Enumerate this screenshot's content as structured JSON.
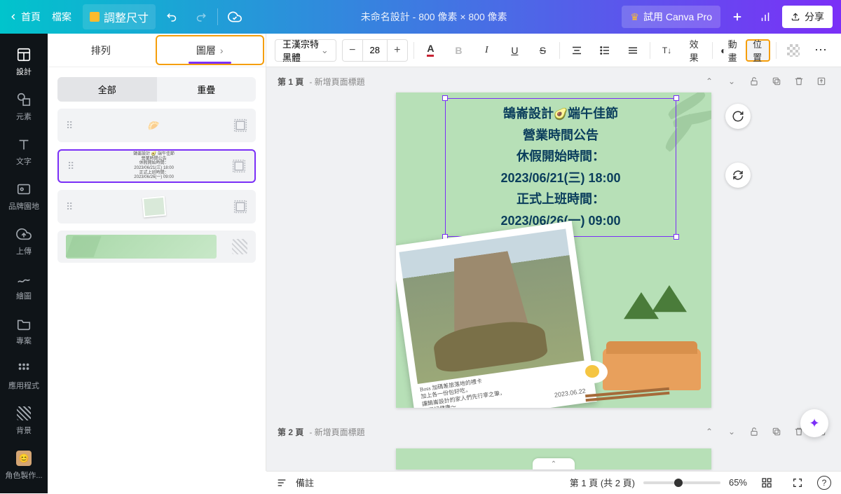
{
  "header": {
    "home": "首頁",
    "file": "檔案",
    "resize": "調整尺寸",
    "title": "未命名設計 - 800 像素 × 800 像素",
    "try_pro": "試用 Canva Pro",
    "share": "分享"
  },
  "rail": [
    {
      "label": "設計"
    },
    {
      "label": "元素"
    },
    {
      "label": "文字"
    },
    {
      "label": "品牌園地"
    },
    {
      "label": "上傳"
    },
    {
      "label": "繪圖"
    },
    {
      "label": "專案"
    },
    {
      "label": "應用程式"
    },
    {
      "label": "背景"
    },
    {
      "label": "角色製作..."
    }
  ],
  "sidepanel": {
    "tab_arrange": "排列",
    "tab_layers": "圖層",
    "seg_all": "全部",
    "seg_overlap": "重疊",
    "layer_text": "鵠崙設計 🥑 端午佳節\n營業時間公告\n休假開始時間：\n2023/06/21(三) 18:00\n正式上班時間：\n2023/06/26(一) 09:00"
  },
  "toolbar": {
    "font": "王漢宗特黑體",
    "size": "28",
    "effects": "效果",
    "animate": "動畫",
    "position": "位置"
  },
  "pages": {
    "p1_label": "第 1 頁",
    "p1_sub": "- 新增頁面標題",
    "p2_label": "第 2 頁",
    "p2_sub": "- 新增頁面標題"
  },
  "canvas_text": {
    "l1a": "鵠崙設計",
    "l1b": "端午佳節",
    "l2": "營業時間公告",
    "l3": "休假開始時間：",
    "l4": "2023/06/21(三) 18:00",
    "l5": "正式上班時間：",
    "l6": "2023/06/26(一) 09:00",
    "photo_date": "2023.06.22"
  },
  "footer": {
    "notes": "備註",
    "page_indicator": "第 1 頁 (共 2 頁)",
    "zoom": "65%"
  }
}
